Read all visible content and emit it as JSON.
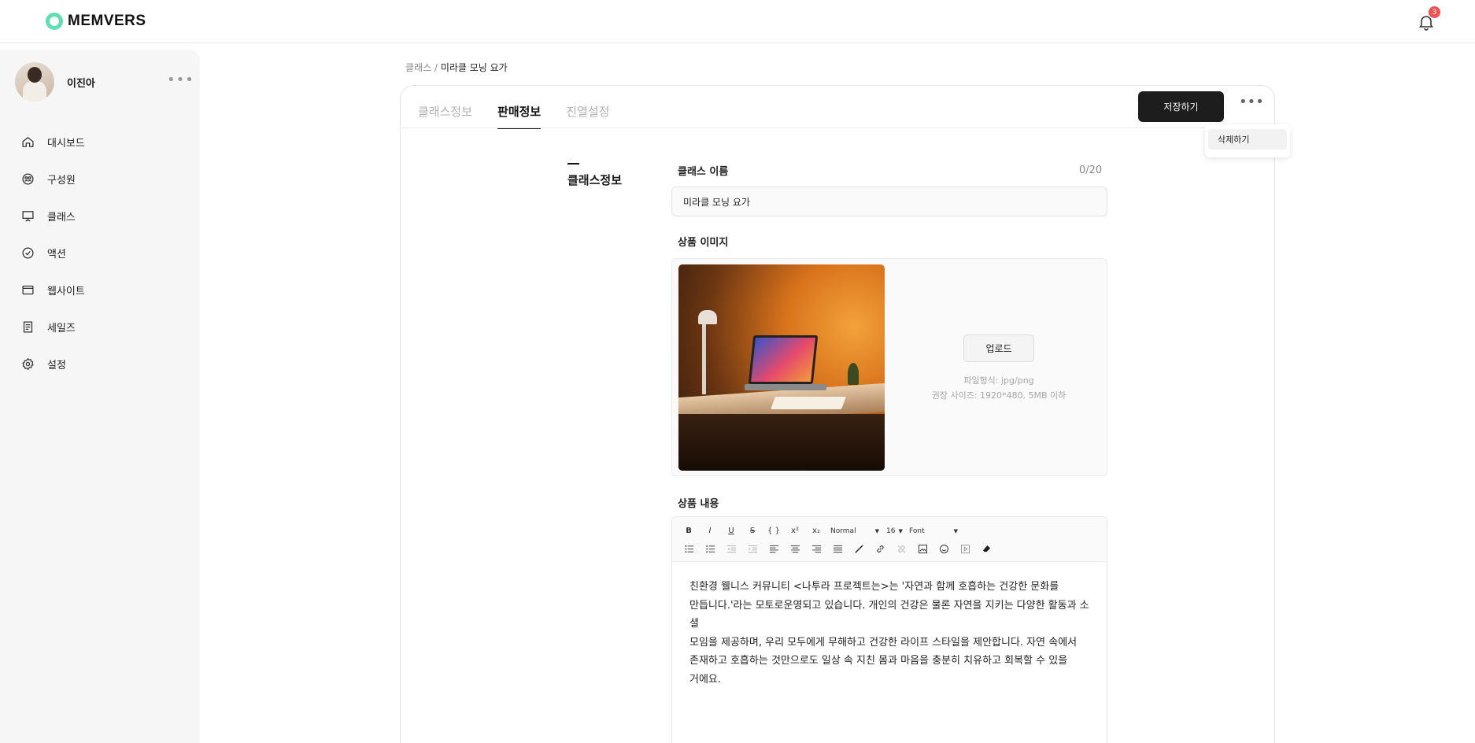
{
  "brand": {
    "name": "MEMVERS",
    "accent": "#5ee0b0"
  },
  "notifications": {
    "count": "3",
    "badge_color": "#f05252"
  },
  "profile": {
    "name": "이진아"
  },
  "sidebar": {
    "items": [
      {
        "label": "대시보드",
        "icon": "home-icon"
      },
      {
        "label": "구성원",
        "icon": "members-icon"
      },
      {
        "label": "클래스",
        "icon": "presentation-icon"
      },
      {
        "label": "액션",
        "icon": "check-circle-icon"
      },
      {
        "label": "웹사이트",
        "icon": "browser-window-icon"
      },
      {
        "label": "세일즈",
        "icon": "receipt-icon"
      },
      {
        "label": "설정",
        "icon": "gear-icon"
      }
    ]
  },
  "breadcrumb": {
    "parent": "클래스 /",
    "current": "미라클 모닝 요가"
  },
  "tabs": [
    {
      "label": "클래스정보",
      "active": false
    },
    {
      "label": "판매정보",
      "active": true
    },
    {
      "label": "진열설정",
      "active": false
    }
  ],
  "actions": {
    "save_label": "저장하기",
    "menu_items": [
      "삭제하기"
    ]
  },
  "section": {
    "title": "클래스정보"
  },
  "form": {
    "name_label": "클래스 이름",
    "name_counter": "0/20",
    "name_value": "미라클 모닝 요가",
    "image_label": "상품 이미지",
    "upload_label": "업로드",
    "upload_hint_format": "파일형식: jpg/png",
    "upload_hint_size": "권장 사이즈: 1920*480, 5MB 이하",
    "content_label": "상품 내용"
  },
  "editor": {
    "toolbar_row1": [
      "B",
      "I",
      "U",
      "S",
      "{ }",
      "x²",
      "x₂"
    ],
    "format_select": "Normal",
    "size_select": "16",
    "font_select": "Font",
    "content_lines": [
      "친환경 웰니스 커뮤니티 <나투라 프로젝트는>는 '자연과 함께 호흡하는 건강한 문화를",
      "만듭니다.'라는 모토로운영되고 있습니다. 개인의 건강은 물론 자연을 지키는 다양한 활동과 소셜",
      "모임을 제공하며, 우리 모두에게 무해하고 건강한 라이프 스타일을 제안합니다. 자연 속에서",
      "존재하고 호흡하는 것만으로도 일상 속 지친 몸과 마음을 충분히 치유하고 회복할 수 있을",
      "거에요."
    ]
  }
}
